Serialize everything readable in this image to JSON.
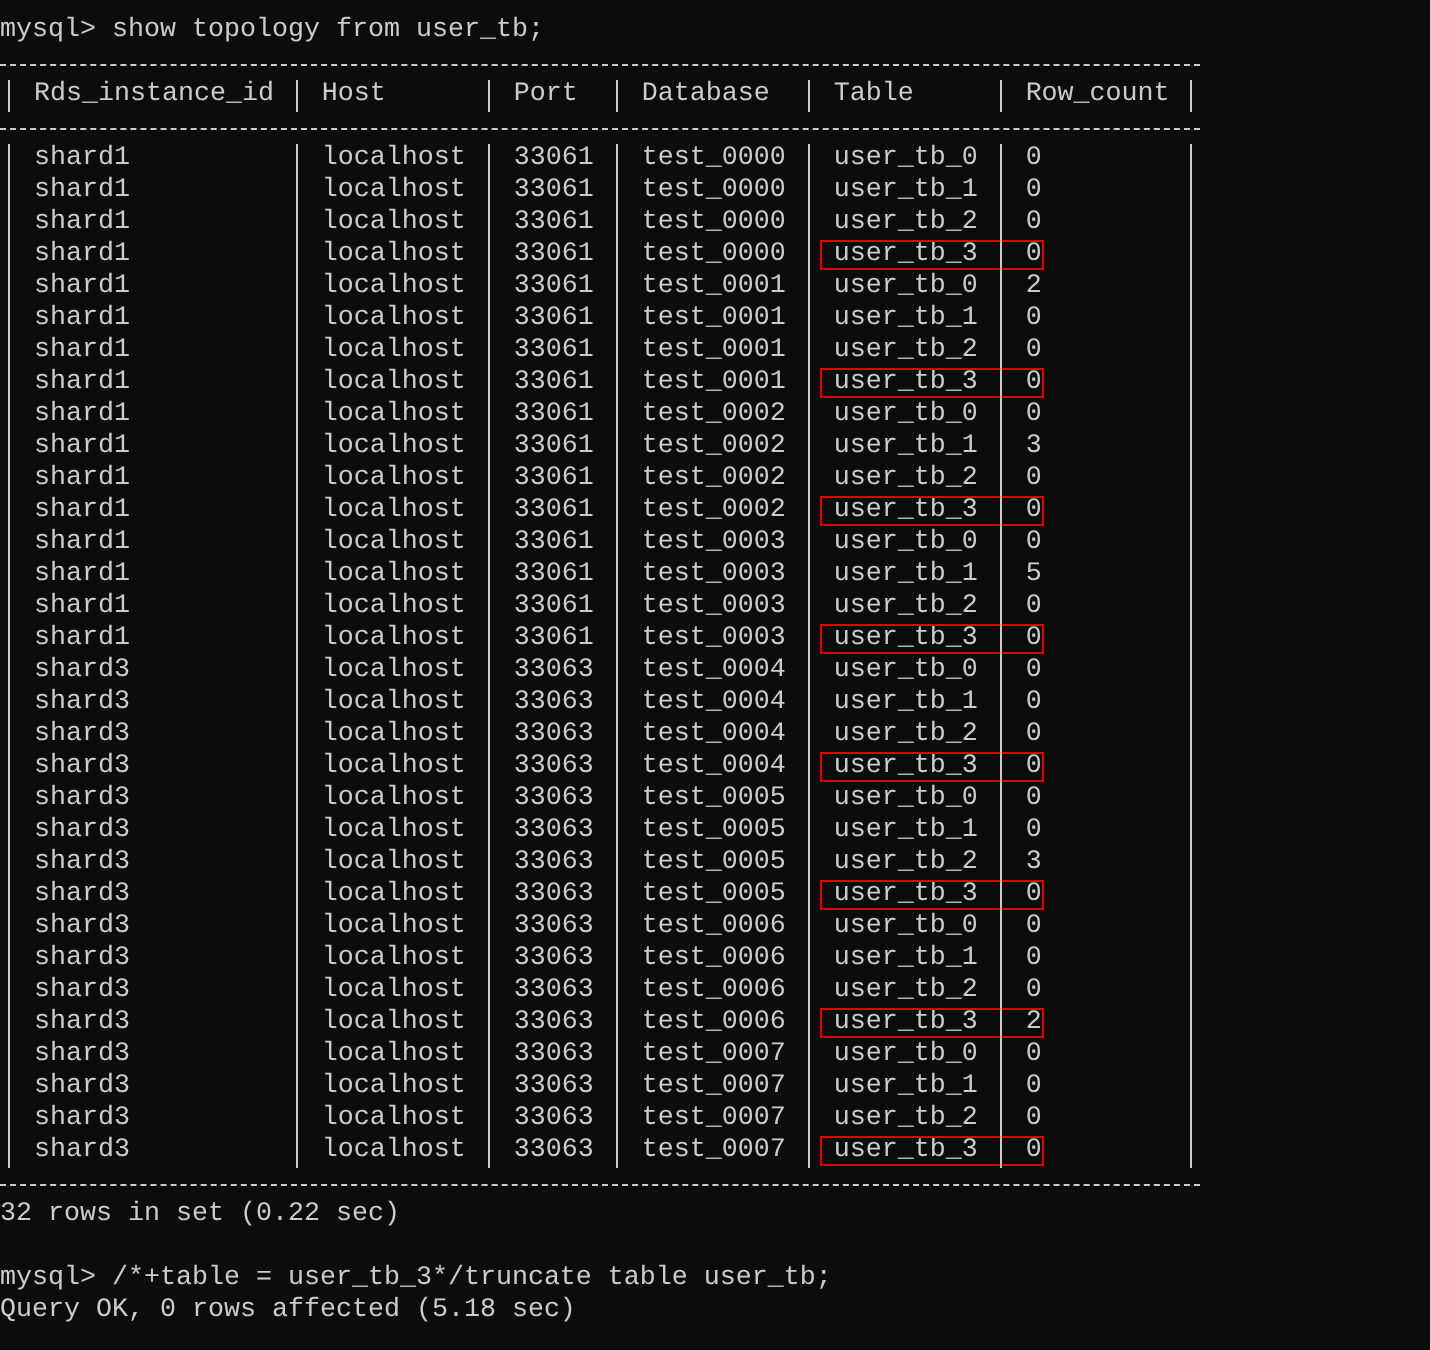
{
  "lines_before": [
    {
      "kind": "command",
      "text": "mysql> show topology from user_tb;"
    }
  ],
  "table": {
    "columns": [
      "Rds_instance_id",
      "Host",
      "Port",
      "Database",
      "Table",
      "Row_count"
    ],
    "rows": [
      {
        "cells": [
          "shard1",
          "localhost",
          "33061",
          "test_0000",
          "user_tb_0",
          "0"
        ],
        "highlighted": false
      },
      {
        "cells": [
          "shard1",
          "localhost",
          "33061",
          "test_0000",
          "user_tb_1",
          "0"
        ],
        "highlighted": false
      },
      {
        "cells": [
          "shard1",
          "localhost",
          "33061",
          "test_0000",
          "user_tb_2",
          "0"
        ],
        "highlighted": false
      },
      {
        "cells": [
          "shard1",
          "localhost",
          "33061",
          "test_0000",
          "user_tb_3",
          "0"
        ],
        "highlighted": true
      },
      {
        "cells": [
          "shard1",
          "localhost",
          "33061",
          "test_0001",
          "user_tb_0",
          "2"
        ],
        "highlighted": false
      },
      {
        "cells": [
          "shard1",
          "localhost",
          "33061",
          "test_0001",
          "user_tb_1",
          "0"
        ],
        "highlighted": false
      },
      {
        "cells": [
          "shard1",
          "localhost",
          "33061",
          "test_0001",
          "user_tb_2",
          "0"
        ],
        "highlighted": false
      },
      {
        "cells": [
          "shard1",
          "localhost",
          "33061",
          "test_0001",
          "user_tb_3",
          "0"
        ],
        "highlighted": true
      },
      {
        "cells": [
          "shard1",
          "localhost",
          "33061",
          "test_0002",
          "user_tb_0",
          "0"
        ],
        "highlighted": false
      },
      {
        "cells": [
          "shard1",
          "localhost",
          "33061",
          "test_0002",
          "user_tb_1",
          "3"
        ],
        "highlighted": false
      },
      {
        "cells": [
          "shard1",
          "localhost",
          "33061",
          "test_0002",
          "user_tb_2",
          "0"
        ],
        "highlighted": false
      },
      {
        "cells": [
          "shard1",
          "localhost",
          "33061",
          "test_0002",
          "user_tb_3",
          "0"
        ],
        "highlighted": true
      },
      {
        "cells": [
          "shard1",
          "localhost",
          "33061",
          "test_0003",
          "user_tb_0",
          "0"
        ],
        "highlighted": false
      },
      {
        "cells": [
          "shard1",
          "localhost",
          "33061",
          "test_0003",
          "user_tb_1",
          "5"
        ],
        "highlighted": false
      },
      {
        "cells": [
          "shard1",
          "localhost",
          "33061",
          "test_0003",
          "user_tb_2",
          "0"
        ],
        "highlighted": false
      },
      {
        "cells": [
          "shard1",
          "localhost",
          "33061",
          "test_0003",
          "user_tb_3",
          "0"
        ],
        "highlighted": true
      },
      {
        "cells": [
          "shard3",
          "localhost",
          "33063",
          "test_0004",
          "user_tb_0",
          "0"
        ],
        "highlighted": false
      },
      {
        "cells": [
          "shard3",
          "localhost",
          "33063",
          "test_0004",
          "user_tb_1",
          "0"
        ],
        "highlighted": false
      },
      {
        "cells": [
          "shard3",
          "localhost",
          "33063",
          "test_0004",
          "user_tb_2",
          "0"
        ],
        "highlighted": false
      },
      {
        "cells": [
          "shard3",
          "localhost",
          "33063",
          "test_0004",
          "user_tb_3",
          "0"
        ],
        "highlighted": true
      },
      {
        "cells": [
          "shard3",
          "localhost",
          "33063",
          "test_0005",
          "user_tb_0",
          "0"
        ],
        "highlighted": false
      },
      {
        "cells": [
          "shard3",
          "localhost",
          "33063",
          "test_0005",
          "user_tb_1",
          "0"
        ],
        "highlighted": false
      },
      {
        "cells": [
          "shard3",
          "localhost",
          "33063",
          "test_0005",
          "user_tb_2",
          "3"
        ],
        "highlighted": false
      },
      {
        "cells": [
          "shard3",
          "localhost",
          "33063",
          "test_0005",
          "user_tb_3",
          "0"
        ],
        "highlighted": true
      },
      {
        "cells": [
          "shard3",
          "localhost",
          "33063",
          "test_0006",
          "user_tb_0",
          "0"
        ],
        "highlighted": false
      },
      {
        "cells": [
          "shard3",
          "localhost",
          "33063",
          "test_0006",
          "user_tb_1",
          "0"
        ],
        "highlighted": false
      },
      {
        "cells": [
          "shard3",
          "localhost",
          "33063",
          "test_0006",
          "user_tb_2",
          "0"
        ],
        "highlighted": false
      },
      {
        "cells": [
          "shard3",
          "localhost",
          "33063",
          "test_0006",
          "user_tb_3",
          "2"
        ],
        "highlighted": true
      },
      {
        "cells": [
          "shard3",
          "localhost",
          "33063",
          "test_0007",
          "user_tb_0",
          "0"
        ],
        "highlighted": false
      },
      {
        "cells": [
          "shard3",
          "localhost",
          "33063",
          "test_0007",
          "user_tb_1",
          "0"
        ],
        "highlighted": false
      },
      {
        "cells": [
          "shard3",
          "localhost",
          "33063",
          "test_0007",
          "user_tb_2",
          "0"
        ],
        "highlighted": false
      },
      {
        "cells": [
          "shard3",
          "localhost",
          "33063",
          "test_0007",
          "user_tb_3",
          "0"
        ],
        "highlighted": true
      }
    ]
  },
  "lines_after": [
    {
      "kind": "output",
      "text": "32 rows in set (0.22 sec)"
    },
    {
      "kind": "blank"
    },
    {
      "kind": "command",
      "text": "mysql> /*+table = user_tb_3*/truncate table user_tb;"
    },
    {
      "kind": "output",
      "text": "Query OK, 0 rows affected (5.18 sec)"
    }
  ]
}
